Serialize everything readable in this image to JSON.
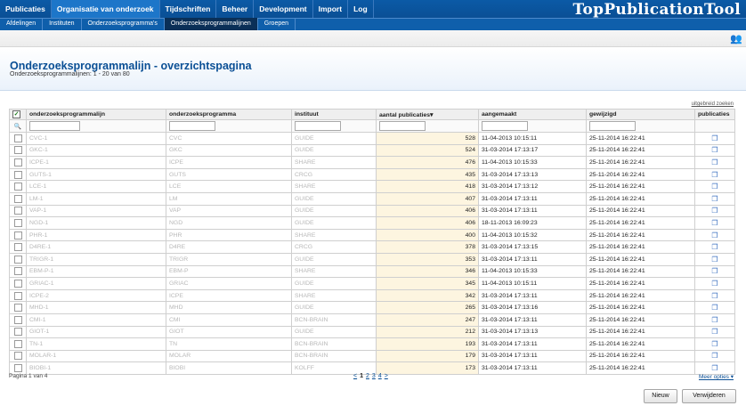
{
  "nav": {
    "items": [
      "Publicaties",
      "Organisatie van onderzoek",
      "Tijdschriften",
      "Beheer",
      "Development",
      "Import",
      "Log"
    ],
    "active_index": 1,
    "brand": "TopPublicationTool"
  },
  "subnav": {
    "items": [
      "Afdelingen",
      "Instituten",
      "Onderzoeksprogramma's",
      "Onderzoeksprogrammalijnen",
      "Groepen"
    ],
    "active_index": 3
  },
  "header": {
    "title": "Onderzoeksprogrammalijn - overzichtspagina",
    "subtitle": "Onderzoeksprogrammalijnen: 1 - 20 van 80"
  },
  "advanced_search": "uitgebreid zoeken",
  "table": {
    "columns": [
      "onderzoeksprogrammalijn",
      "onderzoeksprogramma",
      "instituut",
      "aantal publicaties",
      "aangemaakt",
      "gewijzigd",
      "publicaties"
    ],
    "sort_indicator": "▾",
    "rows": [
      {
        "lijn": "CVC-1",
        "prog": "CVC",
        "inst": "GUIDE",
        "aantal": "528",
        "aangemaakt": "11-04-2013 10:15:11",
        "gewijzigd": "25-11-2014 16:22:41"
      },
      {
        "lijn": "GKC-1",
        "prog": "GKC",
        "inst": "GUIDE",
        "aantal": "524",
        "aangemaakt": "31-03-2014 17:13:17",
        "gewijzigd": "25-11-2014 16:22:41"
      },
      {
        "lijn": "ICPE-1",
        "prog": "ICPE",
        "inst": "SHARE",
        "aantal": "476",
        "aangemaakt": "11-04-2013 10:15:33",
        "gewijzigd": "25-11-2014 16:22:41"
      },
      {
        "lijn": "GUTS-1",
        "prog": "GUTS",
        "inst": "CRCG",
        "aantal": "435",
        "aangemaakt": "31-03-2014 17:13:13",
        "gewijzigd": "25-11-2014 16:22:41"
      },
      {
        "lijn": "LCE-1",
        "prog": "LCE",
        "inst": "SHARE",
        "aantal": "418",
        "aangemaakt": "31-03-2014 17:13:12",
        "gewijzigd": "25-11-2014 16:22:41"
      },
      {
        "lijn": "LM-1",
        "prog": "LM",
        "inst": "GUIDE",
        "aantal": "407",
        "aangemaakt": "31-03-2014 17:13:11",
        "gewijzigd": "25-11-2014 16:22:41"
      },
      {
        "lijn": "VAP-1",
        "prog": "VAP",
        "inst": "GUIDE",
        "aantal": "406",
        "aangemaakt": "31-03-2014 17:13:11",
        "gewijzigd": "25-11-2014 16:22:41"
      },
      {
        "lijn": "NGD-1",
        "prog": "NGD",
        "inst": "GUIDE",
        "aantal": "406",
        "aangemaakt": "18-11-2013 16:09:23",
        "gewijzigd": "25-11-2014 16:22:41"
      },
      {
        "lijn": "PHR-1",
        "prog": "PHR",
        "inst": "SHARE",
        "aantal": "400",
        "aangemaakt": "11-04-2013 10:15:32",
        "gewijzigd": "25-11-2014 16:22:41"
      },
      {
        "lijn": "D4RE-1",
        "prog": "D4RE",
        "inst": "CRCG",
        "aantal": "378",
        "aangemaakt": "31-03-2014 17:13:15",
        "gewijzigd": "25-11-2014 16:22:41"
      },
      {
        "lijn": "TRIGR-1",
        "prog": "TRIGR",
        "inst": "GUIDE",
        "aantal": "353",
        "aangemaakt": "31-03-2014 17:13:11",
        "gewijzigd": "25-11-2014 16:22:41"
      },
      {
        "lijn": "EBM-P-1",
        "prog": "EBM-P",
        "inst": "SHARE",
        "aantal": "346",
        "aangemaakt": "11-04-2013 10:15:33",
        "gewijzigd": "25-11-2014 16:22:41"
      },
      {
        "lijn": "GRIAC-1",
        "prog": "GRIAC",
        "inst": "GUIDE",
        "aantal": "345",
        "aangemaakt": "11-04-2013 10:15:11",
        "gewijzigd": "25-11-2014 16:22:41"
      },
      {
        "lijn": "ICPE-2",
        "prog": "ICPE",
        "inst": "SHARE",
        "aantal": "342",
        "aangemaakt": "31-03-2014 17:13:11",
        "gewijzigd": "25-11-2014 16:22:41"
      },
      {
        "lijn": "MHD-1",
        "prog": "MHD",
        "inst": "GUIDE",
        "aantal": "265",
        "aangemaakt": "31-03-2014 17:13:16",
        "gewijzigd": "25-11-2014 16:22:41"
      },
      {
        "lijn": "CMI-1",
        "prog": "CMI",
        "inst": "BCN-BRAIN",
        "aantal": "247",
        "aangemaakt": "31-03-2014 17:13:11",
        "gewijzigd": "25-11-2014 16:22:41"
      },
      {
        "lijn": "GIOT-1",
        "prog": "GIOT",
        "inst": "GUIDE",
        "aantal": "212",
        "aangemaakt": "31-03-2014 17:13:13",
        "gewijzigd": "25-11-2014 16:22:41"
      },
      {
        "lijn": "TN-1",
        "prog": "TN",
        "inst": "BCN-BRAIN",
        "aantal": "193",
        "aangemaakt": "31-03-2014 17:13:11",
        "gewijzigd": "25-11-2014 16:22:41"
      },
      {
        "lijn": "MOLAR-1",
        "prog": "MOLAR",
        "inst": "BCN-BRAIN",
        "aantal": "179",
        "aangemaakt": "31-03-2014 17:13:11",
        "gewijzigd": "25-11-2014 16:22:41"
      },
      {
        "lijn": "BIOBI-1",
        "prog": "BIOBI",
        "inst": "KOLFF",
        "aantal": "173",
        "aangemaakt": "31-03-2014 17:13:11",
        "gewijzigd": "25-11-2014 16:22:41"
      }
    ]
  },
  "footer": {
    "page_info": "Pagina 1 van 4",
    "pager": [
      "<",
      "1",
      "2",
      "3",
      "4",
      ">"
    ],
    "current_page": "1",
    "meer_opties": "Meer opties ▾"
  },
  "buttons": {
    "new": "Nieuw",
    "delete": "Verwijderen"
  },
  "icons": {
    "top_right": "users-icon",
    "row_action": "copy-documents-icon",
    "filter": "search-icon"
  }
}
